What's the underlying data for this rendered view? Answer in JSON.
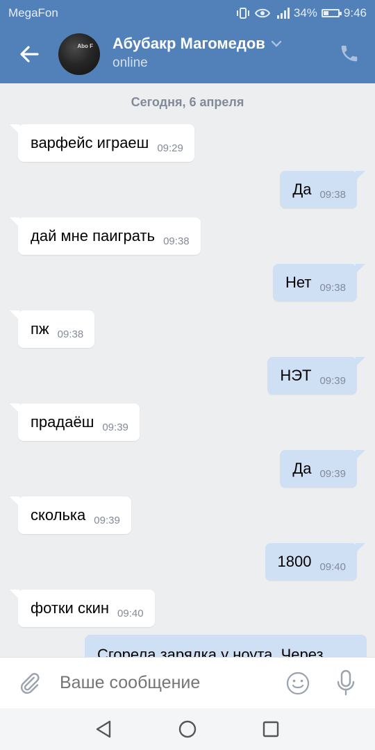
{
  "status_bar": {
    "carrier": "MegaFon",
    "battery": "34%",
    "battery_level": 0.34,
    "time": "9:46"
  },
  "header": {
    "contact_name": "Абубакр Магомедов",
    "status": "online",
    "avatar_text": "Abo F"
  },
  "date_separator": "Сегодня, 6 апреля",
  "messages": [
    {
      "direction": "in",
      "text": "варфейс играеш",
      "time": "09:29"
    },
    {
      "direction": "out",
      "text": "Да",
      "time": "09:38"
    },
    {
      "direction": "in",
      "text": "дай мне паиграть",
      "time": "09:38"
    },
    {
      "direction": "out",
      "text": "Нет",
      "time": "09:38"
    },
    {
      "direction": "in",
      "text": "пж",
      "time": "09:38"
    },
    {
      "direction": "out",
      "text": "НЭТ",
      "time": "09:39"
    },
    {
      "direction": "in",
      "text": "прадаёш",
      "time": "09:39"
    },
    {
      "direction": "out",
      "text": "Да",
      "time": "09:39"
    },
    {
      "direction": "in",
      "text": "сколька",
      "time": "09:39"
    },
    {
      "direction": "out",
      "text": "1800",
      "time": "09:40"
    },
    {
      "direction": "in",
      "text": "фотки скин",
      "time": "09:40"
    },
    {
      "direction": "out",
      "text": "Сгорела зарядка у ноута. Через",
      "time": ""
    }
  ],
  "composer": {
    "placeholder": "Ваше сообщение"
  },
  "colors": {
    "header": "#5181b8",
    "background": "#edeef0",
    "outgoing_bubble": "#cfe0f5",
    "incoming_bubble": "#ffffff"
  },
  "icons": {
    "back": "arrow-left-icon",
    "call": "phone-icon",
    "attach": "paperclip-icon",
    "emoji": "smile-icon",
    "voice": "microphone-icon",
    "nav": [
      "back-triangle-icon",
      "home-circle-icon",
      "recents-square-icon"
    ]
  }
}
